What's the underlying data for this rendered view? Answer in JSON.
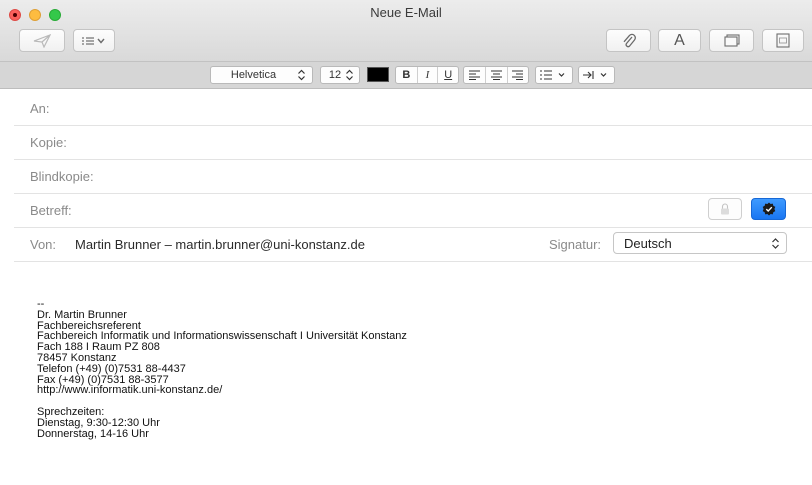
{
  "window": {
    "title": "Neue E-Mail"
  },
  "toolbar": {
    "send_icon": "paper-plane-icon",
    "header_fields_icon": "list-options-icon",
    "attach_icon": "paperclip-icon",
    "format_label": "A",
    "photo_browser_icon": "photo-browser-icon",
    "stationery_icon": "stationery-icon"
  },
  "format_bar": {
    "font": "Helvetica",
    "font_size": "12",
    "text_color": "#000000",
    "bold": "B",
    "italic": "I",
    "underline": "U"
  },
  "fields": {
    "to_label": "An:",
    "cc_label": "Kopie:",
    "bcc_label": "Blindkopie:",
    "subject_label": "Betreff:",
    "from_label": "Von:",
    "from_value": "Martin Brunner – martin.brunner@uni-konstanz.de",
    "signature_label": "Signatur:",
    "signature_value": "Deutsch"
  },
  "signature": {
    "lines": [
      "--",
      "Dr. Martin Brunner",
      "Fachbereichsreferent",
      "Fachbereich Informatik und Informationswissenschaft I Universität Konstanz",
      "Fach 188 I Raum PZ 808",
      "78457 Konstanz",
      "Telefon (+49) (0)7531 88-4437",
      "Fax (+49) (0)7531 88-3577",
      "http://www.informatik.uni-konstanz.de/",
      "",
      "Sprechzeiten:",
      "Dienstag, 9:30-12:30 Uhr",
      "Donnerstag, 14-16 Uhr"
    ]
  },
  "colors": {
    "accent": "#1a77f2",
    "format_bar": "#d6d6d6",
    "label": "#8a8a8a"
  }
}
